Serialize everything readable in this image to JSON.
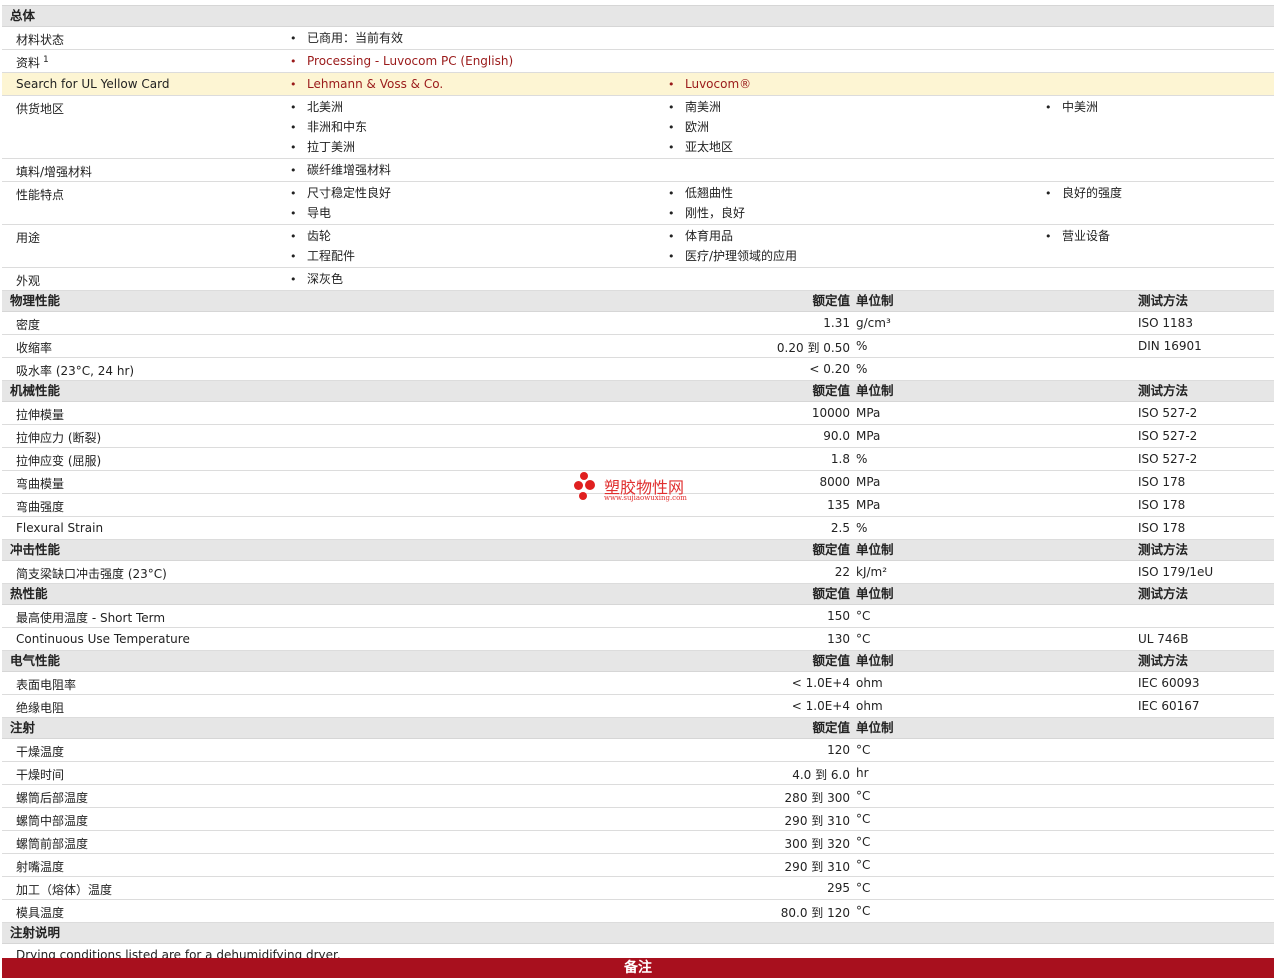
{
  "general": {
    "title": "总体",
    "material_status": {
      "label": "材料状态",
      "value": "已商用：当前有效"
    },
    "info": {
      "label": "资料",
      "sup": "1",
      "value": "Processing - Luvocom PC (English)"
    },
    "ul": {
      "label": "Search for UL Yellow Card",
      "v1": "Lehmann & Voss & Co.",
      "v2": "Luvocom®"
    },
    "supply": {
      "label": "供货地区",
      "col1": [
        "北美洲",
        "非洲和中东",
        "拉丁美洲"
      ],
      "col2": [
        "南美洲",
        "欧洲",
        "亚太地区"
      ],
      "col3": [
        "中美洲"
      ]
    },
    "filler": {
      "label": "填料/增强材料",
      "value": "碳纤维增强材料"
    },
    "features": {
      "label": "性能特点",
      "col1": [
        "尺寸稳定性良好",
        "导电"
      ],
      "col2": [
        "低翘曲性",
        "刚性，良好"
      ],
      "col3": [
        "良好的强度"
      ]
    },
    "uses": {
      "label": "用途",
      "col1": [
        "齿轮",
        "工程配件"
      ],
      "col2": [
        "体育用品",
        "医疗/护理领域的应用"
      ],
      "col3": [
        "营业设备"
      ]
    },
    "appearance": {
      "label": "外观",
      "value": "深灰色"
    }
  },
  "headers": {
    "value": "额定值",
    "unit": "单位制",
    "method": "测试方法"
  },
  "physical": {
    "title": "物理性能",
    "rows": [
      {
        "label": "密度",
        "value": "1.31",
        "unit": "g/cm³",
        "method": "ISO 1183"
      },
      {
        "label": "收缩率",
        "value": "0.20 到  0.50",
        "unit": "%",
        "method": "DIN 16901"
      },
      {
        "label": "吸水率  (23°C, 24 hr)",
        "value": "< 0.20",
        "unit": "%",
        "method": ""
      }
    ]
  },
  "mechanical": {
    "title": "机械性能",
    "rows": [
      {
        "label": "拉伸模量",
        "value": "10000",
        "unit": "MPa",
        "method": "ISO 527-2"
      },
      {
        "label": "拉伸应力  (断裂)",
        "value": "90.0",
        "unit": "MPa",
        "method": "ISO 527-2"
      },
      {
        "label": "拉伸应变  (屈服)",
        "value": "1.8",
        "unit": "%",
        "method": "ISO 527-2"
      },
      {
        "label": "弯曲模量",
        "value": "8000",
        "unit": "MPa",
        "method": "ISO 178"
      },
      {
        "label": "弯曲强度",
        "value": "135",
        "unit": "MPa",
        "method": "ISO 178"
      },
      {
        "label": "Flexural Strain",
        "value": "2.5",
        "unit": "%",
        "method": "ISO 178"
      }
    ]
  },
  "impact": {
    "title": "冲击性能",
    "rows": [
      {
        "label": "简支梁缺口冲击强度  (23°C)",
        "value": "22",
        "unit": "kJ/m²",
        "method": "ISO 179/1eU"
      }
    ]
  },
  "thermal": {
    "title": "热性能",
    "rows": [
      {
        "label": "最高使用温度  - Short Term",
        "value": "150",
        "unit": "°C",
        "method": ""
      },
      {
        "label": "Continuous Use Temperature",
        "value": "130",
        "unit": "°C",
        "method": "UL 746B"
      }
    ]
  },
  "electrical": {
    "title": "电气性能",
    "rows": [
      {
        "label": "表面电阻率",
        "value": "< 1.0E+4",
        "unit": "ohm",
        "method": "IEC 60093"
      },
      {
        "label": "绝缘电阻",
        "value": "< 1.0E+4",
        "unit": "ohm",
        "method": "IEC 60167"
      }
    ]
  },
  "injection": {
    "title": "注射",
    "rows": [
      {
        "label": "干燥温度",
        "value": "120",
        "unit": "°C"
      },
      {
        "label": "干燥时间",
        "value": "4.0 到  6.0",
        "unit": "hr"
      },
      {
        "label": "螺筒后部温度",
        "value": "280 到  300",
        "unit": "°C"
      },
      {
        "label": "螺筒中部温度",
        "value": "290 到  310",
        "unit": "°C"
      },
      {
        "label": "螺筒前部温度",
        "value": "300 到  320",
        "unit": "°C"
      },
      {
        "label": "射嘴温度",
        "value": "290 到  310",
        "unit": "°C"
      },
      {
        "label": "加工（熔体）温度",
        "value": "295",
        "unit": "°C"
      },
      {
        "label": "模具温度",
        "value": "80.0 到  120",
        "unit": "°C"
      }
    ]
  },
  "injection_notes": {
    "title": "注射说明",
    "text": "Drying conditions listed are for a dehumidifying dryer."
  },
  "footer": {
    "label": "备注"
  },
  "watermark": {
    "name": "塑胶物性网",
    "url": "www.sujiaowuxing.com"
  }
}
